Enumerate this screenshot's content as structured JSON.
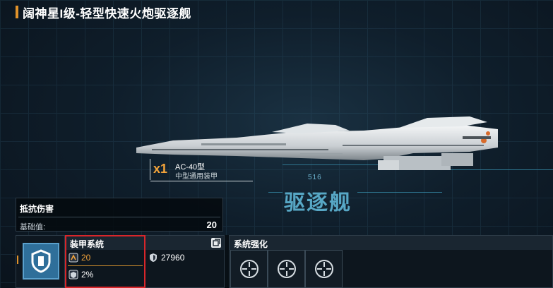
{
  "title": "阔神星I级-轻型快速火炮驱逐舰",
  "weapon": {
    "count": "x1",
    "name": "AC-40型",
    "type": "中型通用装甲"
  },
  "hud_number": "516",
  "ship_class": "驱逐舰",
  "damage_panel": {
    "title": "抵抗伤害",
    "base_label": "基础值:",
    "base_value": "20"
  },
  "armor_system": {
    "title": "装甲系统",
    "armor_value": "20",
    "hp_value": "27960",
    "resist_percent": "2%",
    "expand_icon": "expand-icon"
  },
  "enhancement": {
    "title": "系统强化",
    "slots": [
      "crosshair-icon",
      "crosshair-icon",
      "crosshair-icon"
    ]
  },
  "colors": {
    "accent": "#e0922a",
    "highlight_red": "#d8262a",
    "class_blue": "#5fb6d6"
  }
}
